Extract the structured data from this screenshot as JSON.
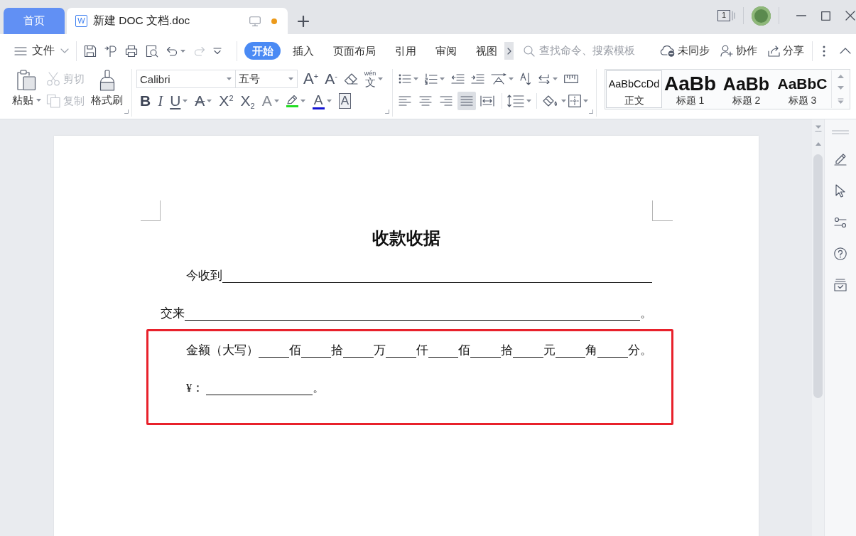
{
  "tabs": [
    {
      "kind": "home",
      "label": "首页",
      "selected": false
    },
    {
      "kind": "document",
      "icon": "W",
      "label": "新建 DOC 文档.doc",
      "selected": true,
      "unsaved": true
    }
  ],
  "window_count": "1",
  "file_menu": "文件",
  "quick_access": [
    {
      "kind": "save",
      "disabled": false
    },
    {
      "kind": "export",
      "disabled": false
    },
    {
      "kind": "print",
      "disabled": false
    },
    {
      "kind": "preview",
      "disabled": false
    },
    {
      "kind": "undo",
      "disabled": false
    },
    {
      "kind": "redo",
      "disabled": true
    },
    {
      "kind": "customize",
      "disabled": false
    }
  ],
  "ribbon_tabs": [
    {
      "label": "开始",
      "selected": true
    },
    {
      "label": "插入",
      "selected": false
    },
    {
      "label": "页面布局",
      "selected": false
    },
    {
      "label": "引用",
      "selected": false
    },
    {
      "label": "审阅",
      "selected": false
    },
    {
      "label": "视图",
      "selected": false
    }
  ],
  "search": {
    "placeholder": "查找命令、搜索模板"
  },
  "actions": [
    {
      "kind": "sync",
      "label": "未同步"
    },
    {
      "kind": "collaborate",
      "label": "协作"
    },
    {
      "kind": "share",
      "label": "分享"
    }
  ],
  "clipboard": {
    "paste": "粘贴",
    "cut": {
      "label": "剪切",
      "disabled": true
    },
    "copy": {
      "label": "复制",
      "disabled": true
    },
    "format_painter": "格式刷"
  },
  "font": {
    "family": "Calibri",
    "size": "五号",
    "size_buttons": [
      {
        "kind": "grow",
        "glyph": "A$^{+}$"
      },
      {
        "kind": "shrink",
        "glyph": "A$^{-}$"
      }
    ],
    "phonetic": {
      "ruby": "wén",
      "glyph": "文"
    },
    "format_buttons": [
      {
        "kind": "bold",
        "glyph": "B"
      },
      {
        "kind": "italic",
        "glyph": "I"
      },
      {
        "kind": "underline",
        "glyph": "U"
      },
      {
        "kind": "strikethrough",
        "glyph": "A"
      },
      {
        "kind": "superscript",
        "glyph": "X$^{2}$"
      },
      {
        "kind": "subscript",
        "glyph": "X$_{2}$"
      },
      {
        "kind": "text_effect",
        "glyph": "A"
      },
      {
        "kind": "highlight",
        "color": "#22dd22"
      },
      {
        "kind": "font_color",
        "glyph": "A",
        "color": "#1414d2"
      },
      {
        "kind": "char_border",
        "glyph": "A"
      }
    ]
  },
  "alignment": [
    {
      "kind": "left",
      "selected": false
    },
    {
      "kind": "center",
      "selected": false
    },
    {
      "kind": "right",
      "selected": false
    },
    {
      "kind": "justify",
      "selected": true
    },
    {
      "kind": "distributed",
      "selected": false
    }
  ],
  "styles": [
    {
      "kind": "body",
      "preview": "AaBbCcDd",
      "label": "正文",
      "selected": true
    },
    {
      "kind": "heading1",
      "preview": "AaBb",
      "label": "标题 1",
      "selected": false
    },
    {
      "kind": "heading2",
      "preview": "AaBb",
      "label": "标题 2",
      "selected": false
    },
    {
      "kind": "heading3",
      "preview": "AaBbC",
      "label": "标题 3",
      "selected": false
    }
  ],
  "document": {
    "title": "收款收据",
    "lines": [
      {
        "kind": "full_blank",
        "label": "今收到",
        "indented": true,
        "highlighted": false
      },
      {
        "kind": "full_blank",
        "label": "交来",
        "end": "。",
        "indented": false,
        "highlighted": false
      },
      {
        "kind": "amount",
        "label": "金额（大写）",
        "units": [
          "佰",
          "拾",
          "万",
          "仟",
          "佰",
          "拾",
          "元",
          "角",
          "分"
        ],
        "end": "。",
        "indented": true,
        "highlighted": true
      },
      {
        "kind": "short_blank",
        "label": "¥：",
        "end": "。",
        "indented": true,
        "highlighted": true
      }
    ]
  }
}
